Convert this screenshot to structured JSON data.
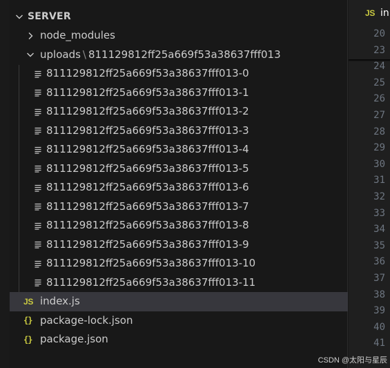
{
  "explorer": {
    "section_title": "SERVER",
    "node_modules": "node_modules",
    "uploads_folder": "uploads",
    "uploads_subfolder": "811129812ff25a669f53a38637fff013",
    "chunks": [
      "811129812ff25a669f53a38637fff013-0",
      "811129812ff25a669f53a38637fff013-1",
      "811129812ff25a669f53a38637fff013-2",
      "811129812ff25a669f53a38637fff013-3",
      "811129812ff25a669f53a38637fff013-4",
      "811129812ff25a669f53a38637fff013-5",
      "811129812ff25a669f53a38637fff013-6",
      "811129812ff25a669f53a38637fff013-7",
      "811129812ff25a669f53a38637fff013-8",
      "811129812ff25a669f53a38637fff013-9",
      "811129812ff25a669f53a38637fff013-10",
      "811129812ff25a669f53a38637fff013-11"
    ],
    "files": [
      "index.js",
      "package-lock.json",
      "package.json"
    ],
    "js_icon": "JS",
    "json_icon": "{}"
  },
  "editor": {
    "tab_label": "in",
    "sticky_lines": [
      "20",
      "23"
    ],
    "line_numbers": [
      "24",
      "25",
      "26",
      "27",
      "28",
      "29",
      "30",
      "31",
      "32",
      "33",
      "34",
      "35",
      "36",
      "37",
      "38",
      "39",
      "40",
      "41"
    ]
  },
  "watermark": "CSDN @太阳与星辰",
  "colors": {
    "background": "#181818",
    "selected_row": "#37373d",
    "js_icon": "#cbcb41",
    "line_number": "#6e7681"
  }
}
